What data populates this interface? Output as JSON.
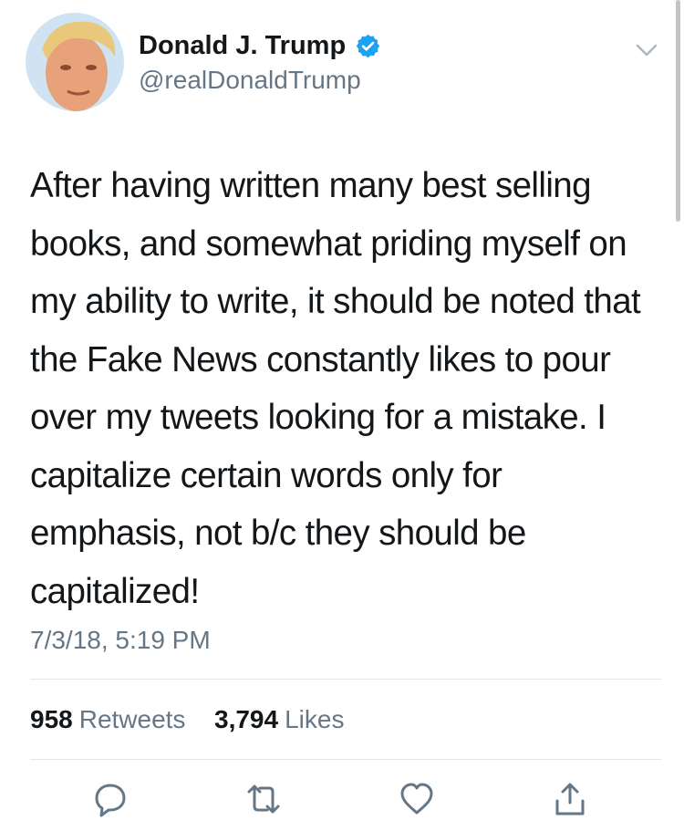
{
  "user": {
    "display_name": "Donald J. Trump",
    "handle": "@realDonaldTrump",
    "verified": true,
    "verified_badge_color": "#1da1f2"
  },
  "tweet": {
    "text": "After having written many best selling books, and somewhat priding myself on my ability to write, it should be noted that the Fake News constantly likes to pour over my tweets looking for a mistake. I capitalize certain words only for emphasis, not b/c they should be capitalized!",
    "timestamp": "7/3/18, 5:19 PM"
  },
  "stats": {
    "retweets_count": "958",
    "retweets_label": "Retweets",
    "likes_count": "3,794",
    "likes_label": "Likes"
  },
  "actions": [
    "reply-icon",
    "retweet-icon",
    "like-icon",
    "share-icon"
  ],
  "colors": {
    "text_primary": "#14171a",
    "text_secondary": "#657786",
    "icon": "#657786",
    "divider": "#e1e8ed"
  }
}
